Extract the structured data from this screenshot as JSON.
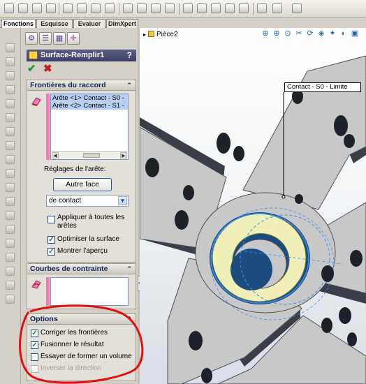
{
  "tabs": [
    {
      "label": "Fonctions",
      "active": true
    },
    {
      "label": "Esquisse",
      "active": false
    },
    {
      "label": "Evaluer",
      "active": false
    },
    {
      "label": "DimXpert",
      "active": false
    }
  ],
  "feature": {
    "title": "Surface-Remplir1",
    "help": "?",
    "ok_symbol": "✔",
    "cancel_symbol": "✖"
  },
  "boundaries": {
    "header": "Frontières du raccord",
    "collapse": "⌃",
    "edges": [
      "Arête <1> Contact - S0 -",
      "Arête <2> Contact - S1 -"
    ],
    "edge_settings_label": "Réglages de l'arête:",
    "other_face_button": "Autre face",
    "contact_select": "de contact",
    "apply_all_label_line1": "Appliquer à toutes les",
    "apply_all_label_line2": "arêtes",
    "apply_all_checked": false,
    "optimize_label": "Optimiser la surface",
    "optimize_checked": true,
    "preview_label": "Montrer l'aperçu",
    "preview_checked": true
  },
  "constraint_curves": {
    "header": "Courbes de contrainte",
    "collapse": "⌃"
  },
  "options": {
    "header": "Options",
    "collapse": "⌃",
    "items": [
      {
        "label": "Corriger les frontières",
        "checked": true,
        "enabled": true
      },
      {
        "label": "Fusionner le résultat",
        "checked": true,
        "enabled": true
      },
      {
        "label": "Essayer de former un volume",
        "checked": false,
        "enabled": true
      },
      {
        "label": "Inverser la direction",
        "checked": false,
        "enabled": false
      }
    ]
  },
  "viewport": {
    "tree_caret": "▸",
    "part_name": "Pièce2",
    "edge_callout": "Contact - S0 - Limite"
  },
  "colors": {
    "panel_bg": "#d4d0c8",
    "title_bar": "#3c3f66",
    "selection_blue": "#3a8df0",
    "part_face": "#c8c8c8",
    "fill_face": "#eef0b8",
    "annotation_red": "#e01010"
  }
}
